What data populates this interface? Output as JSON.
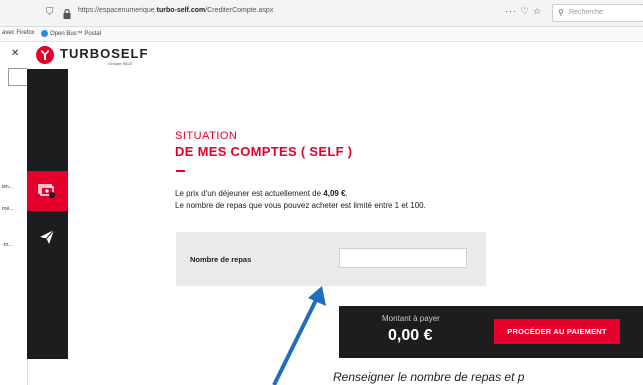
{
  "browser": {
    "url_prefix": "https://espacenumerique.",
    "url_domain": "turbo-self.com",
    "url_path": "/CrediterCompte.aspx",
    "toolbar_icons": "··· ♡ ☆",
    "search_placeholder": "Recherche"
  },
  "bookmarks": {
    "items": [
      {
        "label": "avec Firefox"
      },
      {
        "label": "Open Bus™ Postal"
      }
    ]
  },
  "left_sliver": {
    "texts": [
      "ien...",
      "rné...",
      "-rn..."
    ]
  },
  "header": {
    "logo_text": "TURBOSELF",
    "logo_sub": "Groupe INCB"
  },
  "content": {
    "heading_line1": "SITUATION",
    "heading_line2": "DE MES COMPTES ( SELF )",
    "price_text": "Le prix d'un déjeuner est actuellement de ",
    "price_value": "4,09 €",
    "price_end": ".",
    "limit_text": "Le nombre de repas que vous pouvez acheter est limité entre 1 et 100."
  },
  "form": {
    "meals_label": "Nombre de repas",
    "meals_value": ""
  },
  "payment": {
    "label": "Montant à payer",
    "amount": "0,00 €",
    "button_label": "PROCÉDER AU PAIEMENT"
  },
  "annotation": {
    "caption": "Renseigner le nombre de repas et p"
  },
  "colors": {
    "accent": "#e5002b",
    "sidebar": "#1d1d1f"
  }
}
